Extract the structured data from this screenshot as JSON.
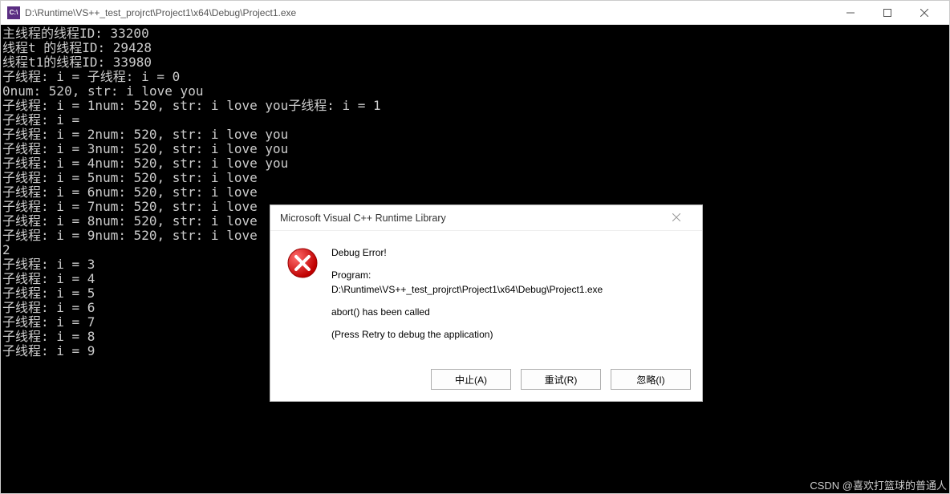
{
  "window": {
    "icon_text": "C:\\",
    "title": "D:\\Runtime\\VS++_test_projrct\\Project1\\x64\\Debug\\Project1.exe"
  },
  "console": {
    "lines": [
      "主线程的线程ID: 33200",
      "线程t 的线程ID: 29428",
      "线程t1的线程ID: 33980",
      "子线程: i = 子线程: i = 0",
      "0num: 520, str: i love you",
      "子线程: i = 1num: 520, str: i love you子线程: i = 1",
      "子线程: i = ",
      "子线程: i = 2num: 520, str: i love you",
      "子线程: i = 3num: 520, str: i love you",
      "子线程: i = 4num: 520, str: i love you",
      "子线程: i = 5num: 520, str: i love ",
      "子线程: i = 6num: 520, str: i love",
      "子线程: i = 7num: 520, str: i love",
      "子线程: i = 8num: 520, str: i love",
      "子线程: i = 9num: 520, str: i love",
      "2",
      "子线程: i = 3",
      "子线程: i = 4",
      "子线程: i = 5",
      "子线程: i = 6",
      "子线程: i = 7",
      "子线程: i = 8",
      "子线程: i = 9"
    ]
  },
  "dialog": {
    "title": "Microsoft Visual C++ Runtime Library",
    "heading": "Debug Error!",
    "program_label": "Program:",
    "program_path": "D:\\Runtime\\VS++_test_projrct\\Project1\\x64\\Debug\\Project1.exe",
    "message": "abort() has been called",
    "hint": "(Press Retry to debug the application)",
    "buttons": {
      "abort": "中止(A)",
      "retry": "重试(R)",
      "ignore": "忽略(I)"
    }
  },
  "watermark": "CSDN @喜欢打篮球的普通人"
}
